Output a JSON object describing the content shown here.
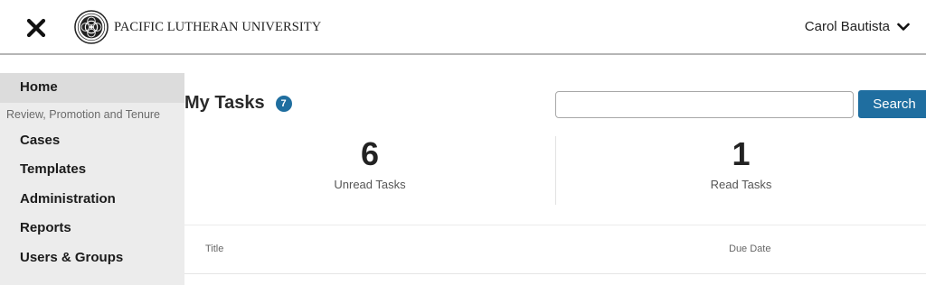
{
  "header": {
    "logo_text": "PACIFIC LUTHERAN UNIVERSITY",
    "user_name": "Carol Bautista",
    "icons": {
      "close": "close-icon",
      "seal": "university-seal-icon",
      "chevron": "chevron-down-icon"
    }
  },
  "sidebar": {
    "home": "Home",
    "section": "Review, Promotion and Tenure",
    "items": [
      {
        "label": "Cases"
      },
      {
        "label": "Templates"
      },
      {
        "label": "Administration"
      },
      {
        "label": "Reports"
      },
      {
        "label": "Users & Groups"
      }
    ]
  },
  "main": {
    "title": "My Tasks",
    "task_count": "7",
    "search": {
      "value": "",
      "button_label": "Search"
    },
    "stats": {
      "unread_count": "6",
      "unread_label": "Unread Tasks",
      "read_count": "1",
      "read_label": "Read Tasks"
    },
    "table": {
      "columns": [
        "Title",
        "Due Date"
      ]
    }
  },
  "colors": {
    "accent": "#1f6ea0",
    "sidebar_bg": "#ececec",
    "sidebar_active": "#dcdcdc"
  }
}
